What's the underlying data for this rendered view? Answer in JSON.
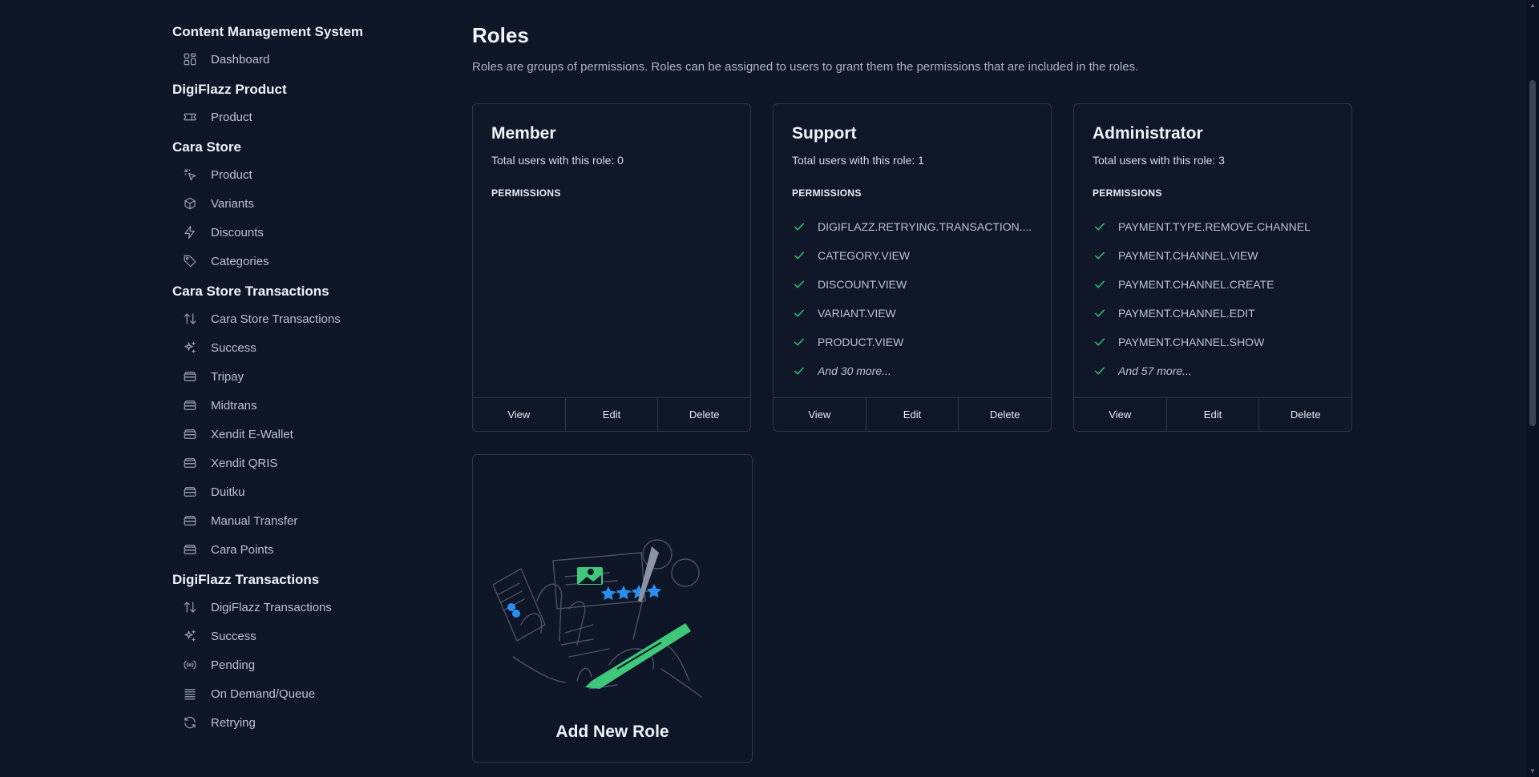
{
  "sidebar": {
    "groups": [
      {
        "title": "Content Management System",
        "items": [
          {
            "label": "Dashboard",
            "icon": "dashboard-icon"
          }
        ]
      },
      {
        "title": "DigiFlazz Product",
        "items": [
          {
            "label": "Product",
            "icon": "ticket-icon"
          }
        ]
      },
      {
        "title": "Cara Store",
        "items": [
          {
            "label": "Product",
            "icon": "cursor-click-icon"
          },
          {
            "label": "Variants",
            "icon": "cube-icon"
          },
          {
            "label": "Discounts",
            "icon": "bolt-icon"
          },
          {
            "label": "Categories",
            "icon": "tag-icon"
          }
        ]
      },
      {
        "title": "Cara Store Transactions",
        "items": [
          {
            "label": "Cara Store Transactions",
            "icon": "arrows-up-down-icon"
          },
          {
            "label": "Success",
            "icon": "sparkles-icon"
          },
          {
            "label": "Tripay",
            "icon": "server-icon"
          },
          {
            "label": "Midtrans",
            "icon": "server-icon"
          },
          {
            "label": "Xendit E-Wallet",
            "icon": "server-icon"
          },
          {
            "label": "Xendit QRIS",
            "icon": "server-icon"
          },
          {
            "label": "Duitku",
            "icon": "server-icon"
          },
          {
            "label": "Manual Transfer",
            "icon": "server-icon"
          },
          {
            "label": "Cara Points",
            "icon": "server-icon"
          }
        ]
      },
      {
        "title": "DigiFlazz Transactions",
        "items": [
          {
            "label": "DigiFlazz Transactions",
            "icon": "arrows-up-down-icon"
          },
          {
            "label": "Success",
            "icon": "sparkles-icon"
          },
          {
            "label": "Pending",
            "icon": "signal-icon"
          },
          {
            "label": "On Demand/Queue",
            "icon": "queue-list-icon"
          },
          {
            "label": "Retrying",
            "icon": "refresh-icon"
          }
        ]
      }
    ]
  },
  "page": {
    "title": "Roles",
    "description": "Roles are groups of permissions. Roles can be assigned to users to grant them the permissions that are included in the roles."
  },
  "roles": [
    {
      "name": "Member",
      "users": "Total users with this role: 0",
      "permissions_title": "PERMISSIONS",
      "permissions": [],
      "more": "",
      "actions": [
        "View",
        "Edit",
        "Delete"
      ]
    },
    {
      "name": "Support",
      "users": "Total users with this role: 1",
      "permissions_title": "PERMISSIONS",
      "permissions": [
        "DIGIFLAZZ.RETRYING.TRANSACTION....",
        "CATEGORY.VIEW",
        "DISCOUNT.VIEW",
        "VARIANT.VIEW",
        "PRODUCT.VIEW"
      ],
      "more": "And 30 more...",
      "actions": [
        "View",
        "Edit",
        "Delete"
      ]
    },
    {
      "name": "Administrator",
      "users": "Total users with this role: 3",
      "permissions_title": "PERMISSIONS",
      "permissions": [
        "PAYMENT.TYPE.REMOVE.CHANNEL",
        "PAYMENT.CHANNEL.VIEW",
        "PAYMENT.CHANNEL.CREATE",
        "PAYMENT.CHANNEL.EDIT",
        "PAYMENT.CHANNEL.SHOW"
      ],
      "more": "And 57 more...",
      "actions": [
        "View",
        "Edit",
        "Delete"
      ]
    }
  ],
  "add_role": {
    "label": "Add New Role"
  },
  "colors": {
    "background": "#0e1628",
    "check": "#35c475",
    "border": "#2d3748",
    "accent_green": "#3fc87a",
    "accent_blue": "#2b8ff0"
  }
}
